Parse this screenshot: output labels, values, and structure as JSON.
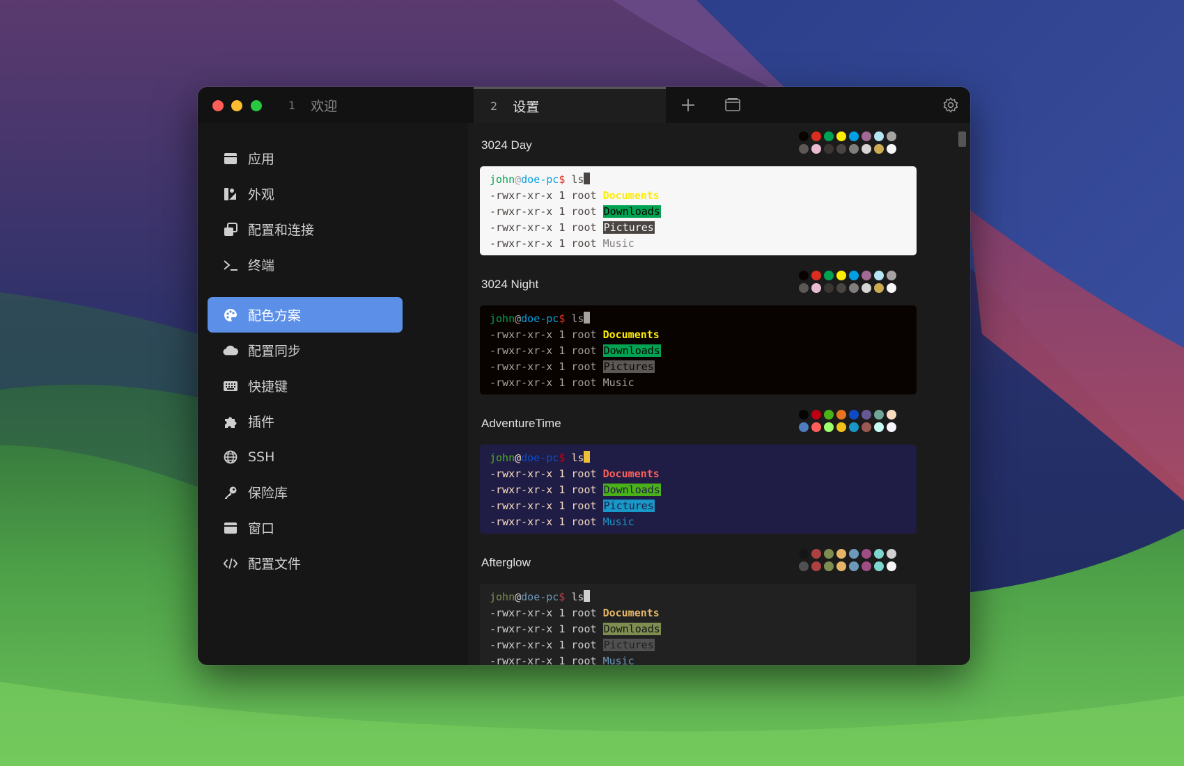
{
  "window": {
    "tabs": [
      {
        "num": "1",
        "label": "欢迎"
      },
      {
        "num": "2",
        "label": "设置"
      }
    ]
  },
  "icons": {
    "new_tab": "plus-icon",
    "split": "window-icon",
    "settings": "gear-icon"
  },
  "sidebar": {
    "items": [
      {
        "label": "应用",
        "icon": "app-window-icon"
      },
      {
        "label": "外观",
        "icon": "appearance-icon"
      },
      {
        "label": "配置和连接",
        "icon": "profiles-icon"
      },
      {
        "label": "终端",
        "icon": "terminal-icon"
      },
      {
        "label": "配色方案",
        "icon": "palette-icon",
        "active": true
      },
      {
        "label": "配置同步",
        "icon": "cloud-icon"
      },
      {
        "label": "快捷键",
        "icon": "keyboard-icon"
      },
      {
        "label": "插件",
        "icon": "puzzle-icon"
      },
      {
        "label": "SSH",
        "icon": "globe-icon"
      },
      {
        "label": "保险库",
        "icon": "key-icon"
      },
      {
        "label": "窗口",
        "icon": "window-icon"
      },
      {
        "label": "配置文件",
        "icon": "code-icon"
      }
    ]
  },
  "terminal_sample": {
    "user": "john",
    "at": "@",
    "host": "doe-pc",
    "prompt": "$",
    "command": " ls",
    "perm": "-rwxr-xr-x 1 root ",
    "entries": [
      "Documents",
      "Downloads",
      "Pictures",
      "Music"
    ]
  },
  "schemes": [
    {
      "name": "3024 Day",
      "bg": "#f7f7f7",
      "fg": "#4a4543",
      "user": "#01a252",
      "at": "#a5a2a2",
      "host": "#01a0e4",
      "dollar": "#db2d20",
      "cursor": "#4a4543",
      "docs": "#fded02",
      "down_fg": "#090300",
      "down_bg": "#01a252",
      "pic_fg": "#f7f7f7",
      "pic_bg": "#4a4543",
      "music": "#807d7c",
      "palette": [
        [
          "#090300",
          "#db2d20",
          "#01a252",
          "#fded02",
          "#01a0e4",
          "#a16a94",
          "#b5e4f4",
          "#a5a2a2"
        ],
        [
          "#5c5855",
          "#e8bbd0",
          "#3a3432",
          "#4a4543",
          "#807d7c",
          "#d6d5d4",
          "#cdab53",
          "#f7f7f7"
        ]
      ]
    },
    {
      "name": "3024 Night",
      "bg": "#090300",
      "fg": "#a5a2a2",
      "user": "#01a252",
      "at": "#a5a2a2",
      "host": "#01a0e4",
      "dollar": "#db2d20",
      "cursor": "#a5a2a2",
      "docs": "#fded02",
      "down_fg": "#090300",
      "down_bg": "#01a252",
      "pic_fg": "#090300",
      "pic_bg": "#5c5855",
      "music": "#a5a2a2",
      "palette": [
        [
          "#090300",
          "#db2d20",
          "#01a252",
          "#fded02",
          "#01a0e4",
          "#a16a94",
          "#b5e4f4",
          "#a5a2a2"
        ],
        [
          "#5c5855",
          "#e8bbd0",
          "#3a3432",
          "#4a4543",
          "#807d7c",
          "#d6d5d4",
          "#cdab53",
          "#f7f7f7"
        ]
      ]
    },
    {
      "name": "AdventureTime",
      "bg": "#1f1d45",
      "fg": "#f8dcc0",
      "user": "#4ab118",
      "at": "#f8dcc0",
      "host": "#0f4ac6",
      "dollar": "#bd0013",
      "cursor": "#efbf38",
      "docs": "#fc5f5a",
      "down_fg": "#1f1d45",
      "down_bg": "#4ab118",
      "pic_fg": "#1f1d45",
      "pic_bg": "#1997c6",
      "music": "#1997c6",
      "palette": [
        [
          "#050404",
          "#bd0013",
          "#4ab118",
          "#e7741e",
          "#0f4ac6",
          "#665993",
          "#70a598",
          "#f8dcc0"
        ],
        [
          "#4e7cbf",
          "#fc5f5a",
          "#9eff6e",
          "#efc11a",
          "#1997c6",
          "#9b5953",
          "#c8faf4",
          "#f6f5fb"
        ]
      ]
    },
    {
      "name": "Afterglow",
      "bg": "#212121",
      "fg": "#d0d0d0",
      "user": "#7e8e50",
      "at": "#d0d0d0",
      "host": "#6c99bb",
      "dollar": "#ac4142",
      "cursor": "#d0d0d0",
      "docs": "#e5b567",
      "down_fg": "#151515",
      "down_bg": "#7e8e50",
      "pic_fg": "#212121",
      "pic_bg": "#505050",
      "music": "#6c99bb",
      "palette": [
        [
          "#151515",
          "#ac4142",
          "#7e8e50",
          "#e5b567",
          "#6c99bb",
          "#9f4e85",
          "#7dd6cf",
          "#d0d0d0"
        ],
        [
          "#505050",
          "#ac4142",
          "#7e8e50",
          "#e5b567",
          "#6c99bb",
          "#9f4e85",
          "#7dd6cf",
          "#f5f5f5"
        ]
      ]
    }
  ]
}
